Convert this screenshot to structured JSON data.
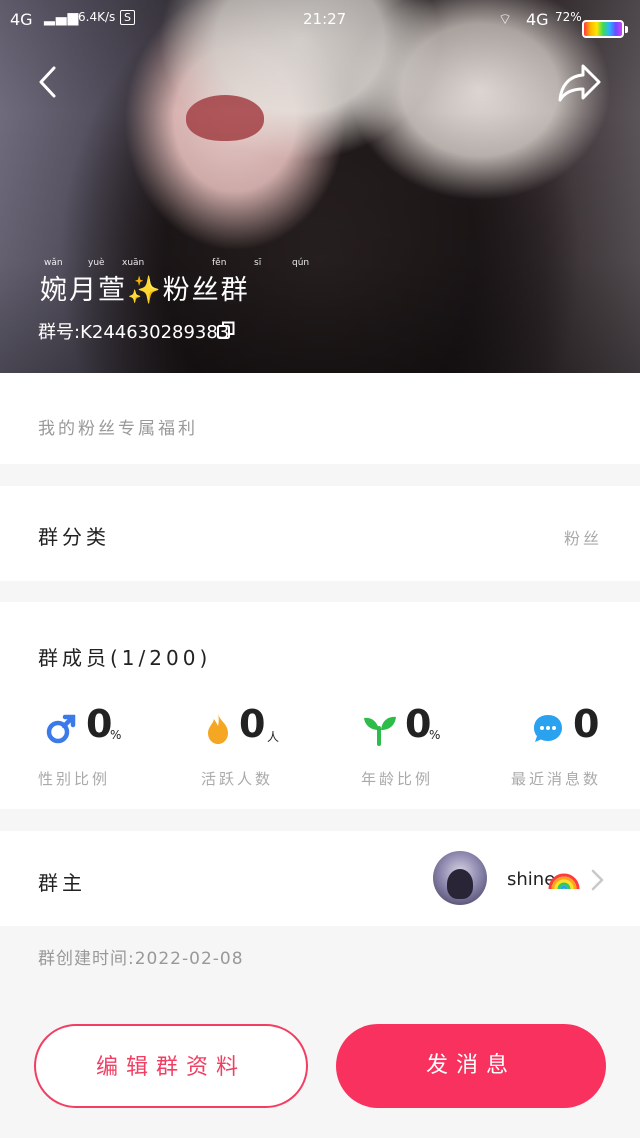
{
  "status_bar": {
    "network_left": "4G",
    "speed": "6.4K/s",
    "s_badge": "S",
    "time": "21:27",
    "network_right": "4G",
    "battery": "72%"
  },
  "header": {
    "group_name": "婉月萱✨粉丝群",
    "pinyin": [
      "wǎn",
      "yuè",
      "xuān",
      "fěn",
      "sī",
      "qún"
    ],
    "group_id": "群号:K244630289383"
  },
  "benefit": {
    "text": "我的粉丝专属福利"
  },
  "category": {
    "label": "群分类",
    "value": "粉丝"
  },
  "members": {
    "label": "群成员(1/200)",
    "stats": [
      {
        "icon": "male-icon",
        "value": "0",
        "unit": "%",
        "label": "性别比例"
      },
      {
        "icon": "flame-icon",
        "value": "0",
        "unit": "人",
        "label": "活跃人数"
      },
      {
        "icon": "sprout-icon",
        "value": "0",
        "unit": "%",
        "label": "年龄比例"
      },
      {
        "icon": "chat-bubble-icon",
        "value": "0",
        "unit": "",
        "label": "最近消息数"
      }
    ]
  },
  "owner": {
    "label": "群主",
    "name": "shine"
  },
  "created": {
    "text": "群创建时间:2022-02-08"
  },
  "buttons": {
    "edit": "编辑群资料",
    "send": "发消息"
  },
  "colors": {
    "accent": "#f8315e",
    "male": "#3b7ae8",
    "flame": "#f5a623",
    "sprout": "#2dbb4a",
    "chat": "#2aa2f0"
  }
}
